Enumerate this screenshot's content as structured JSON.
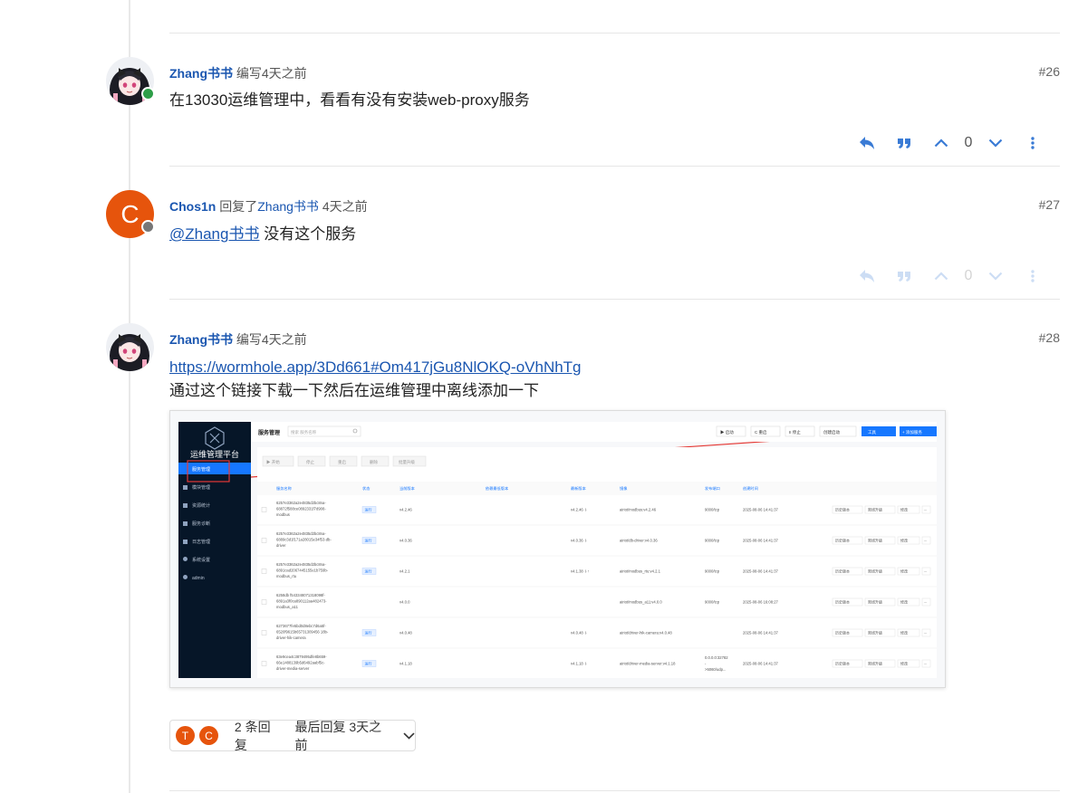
{
  "posts": [
    {
      "user": "Zhang书书",
      "action": "编写4天之前",
      "index": "#26",
      "body": "在13030运维管理中，看看有没有安装web-proxy服务",
      "vote": "0"
    },
    {
      "user": "Chos1n",
      "avatar_letter": "C",
      "action_prefix": "回复了",
      "reply_to": "Zhang书书",
      "time": "4天之前",
      "index": "#27",
      "mention": "@Zhang书书",
      "body": " 没有这个服务",
      "vote": "0"
    },
    {
      "user": "Zhang书书",
      "action": "编写4天之前",
      "index": "#28",
      "link": "https://wormhole.app/3Dd661#Om417jGu8NlOKQ-oVhNhTg",
      "body": "通过这个链接下载一下然后在运维管理中离线添加一下"
    }
  ],
  "screenshot": {
    "sidebar_title": "运维管理平台",
    "menu": [
      "服务管理",
      "模块管理",
      "资源统计",
      "服务诊断",
      "日志管理",
      "系统设置",
      "admin"
    ],
    "page_title": "服务管理",
    "search_placeholder": "搜索 服务名称",
    "top_buttons": [
      "▶ 启动",
      "C 重启",
      "II 停止",
      "创建启动",
      "工具",
      "+ 添加服务"
    ],
    "sub_buttons": [
      "▶ 开始",
      "停止",
      "重启",
      "删除",
      "批量升级"
    ],
    "columns": [
      "服务名称",
      "状态",
      "当前版本",
      "依赖最低版本",
      "最新版本",
      "镜像",
      "发布端口",
      "创建时间"
    ],
    "rows": [
      {
        "name": [
          "6257e3362a2e4835d2bc8na-",
          "68872f588ce0892331f7d908-",
          "modbus"
        ],
        "status": "运行",
        "ver": "v4.2.46",
        "latest": "v4.2.46 ⇩",
        "image": "airiot/modbus:v4.2.46",
        "port": "9000/tcp",
        "time": "2025-08-06 14:41:37"
      },
      {
        "name": [
          "6257e3362a2e4835d2bc8na-",
          "6889c3d1f171a28015e34f53-db-",
          "driver"
        ],
        "status": "运行",
        "ver": "v4.0.36",
        "latest": "v4.0.36 ⇩",
        "image": "airiot/db-driver:v4.0.36",
        "port": "9000/tcp",
        "time": "2025-08-06 14:41:37"
      },
      {
        "name": [
          "6257e3362a2e4835d2bc8na-",
          "6891cad2067445155e1b759b-",
          "modbus_rtu"
        ],
        "status": "运行",
        "ver": "v4.2.1",
        "latest": "v4.1.38 ⇩↑",
        "image": "airiot/modbus_rtu:v4.2.1",
        "port": "9000/tcp",
        "time": "2025-08-06 14:41:37"
      },
      {
        "name": [
          "6258db f543348071318098f-",
          "6891a3f0ca890112aa482473-",
          "modbus_a11"
        ],
        "status": "",
        "ver": "v4.0.0",
        "latest": "",
        "image": "airiot/modbus_a11:v4.0.0",
        "port": "9000/tcp",
        "time": "2025-08-06 16:08:27"
      },
      {
        "name": [
          "6273677fe5bd0d8ebc7d6a5f-",
          "6520f9615b65731309456 18b-",
          "driver-hik-camera"
        ],
        "status": "运行",
        "ver": "v4.0.48",
        "latest": "v4.0.48 ⇩",
        "image": "airiot/driver-hik-camera:v4.0.48",
        "port": "",
        "time": "2025-08-06 14:41:37"
      },
      {
        "name": [
          "63e9cea4c3879495dfe8b659-",
          "66e1488139b5d6492aabf5c-",
          "driver-media-server"
        ],
        "status": "运行",
        "ver": "v4.1.18",
        "latest": "v4.1.18 ⇩",
        "image": "airiot/driver-media-server:v4.1.18",
        "port": "0.0.0.0:32782 - >5060/udp...",
        "time": "2025-08-06 14:41:37"
      }
    ],
    "row_actions": [
      "历史版本",
      "离线升级",
      "修改"
    ]
  },
  "summary": {
    "avatars": [
      "T",
      "C"
    ],
    "replies": "2 条回复",
    "last_reply": "最后回复 3天之前"
  },
  "colors": {
    "link": "#1a56b0",
    "action_icon": "#3a7bd5",
    "avatar_orange": "#e6540c",
    "online": "#2e9e48",
    "offline": "#777777",
    "sidebar": "#061628",
    "primary": "#1677ff"
  }
}
